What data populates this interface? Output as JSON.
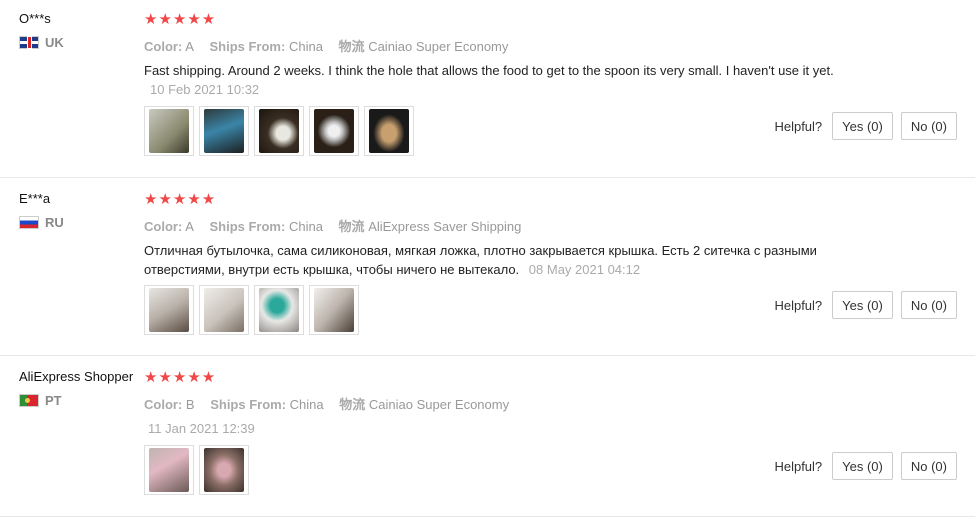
{
  "reviews": [
    {
      "user": "O***s",
      "country": "UK",
      "flag": "uk-flag-icon",
      "stars": "★★★★★",
      "color_label": "Color:",
      "color_value": "A",
      "ships_label": "Ships From:",
      "ships_value": "China",
      "logistics_label": "物流",
      "logistics_value": "Cainiao Super Economy",
      "text": "Fast shipping. Around 2 weeks. I think the hole that allows the food to get to the spoon its very small. I haven't use it yet.",
      "date": "10 Feb 2021 10:32",
      "photo_count": 5,
      "helpful_label": "Helpful?",
      "yes_label": "Yes (0)",
      "no_label": "No (0)"
    },
    {
      "user": "E***a",
      "country": "RU",
      "flag": "ru-flag-icon",
      "stars": "★★★★★",
      "color_label": "Color:",
      "color_value": "A",
      "ships_label": "Ships From:",
      "ships_value": "China",
      "logistics_label": "物流",
      "logistics_value": "AliExpress Saver Shipping",
      "text": "Отличная бутылочка, сама силиконовая, мягкая ложка, плотно закрывается крышка. Есть 2 ситечка с разными отверстиями, внутри есть крышка, чтобы ничего не вытекало.",
      "date": "08 May 2021 04:12",
      "photo_count": 4,
      "helpful_label": "Helpful?",
      "yes_label": "Yes (0)",
      "no_label": "No (0)"
    },
    {
      "user": "AliExpress Shopper",
      "country": "PT",
      "flag": "pt-flag-icon",
      "stars": "★★★★★",
      "color_label": "Color:",
      "color_value": "B",
      "ships_label": "Ships From:",
      "ships_value": "China",
      "logistics_label": "物流",
      "logistics_value": "Cainiao Super Economy",
      "text": "",
      "date": "11 Jan 2021 12:39",
      "photo_count": 2,
      "helpful_label": "Helpful?",
      "yes_label": "Yes (0)",
      "no_label": "No (0)"
    }
  ],
  "colors": {
    "star": "#f04848",
    "muted": "#999999",
    "border": "#e8e8e8"
  }
}
